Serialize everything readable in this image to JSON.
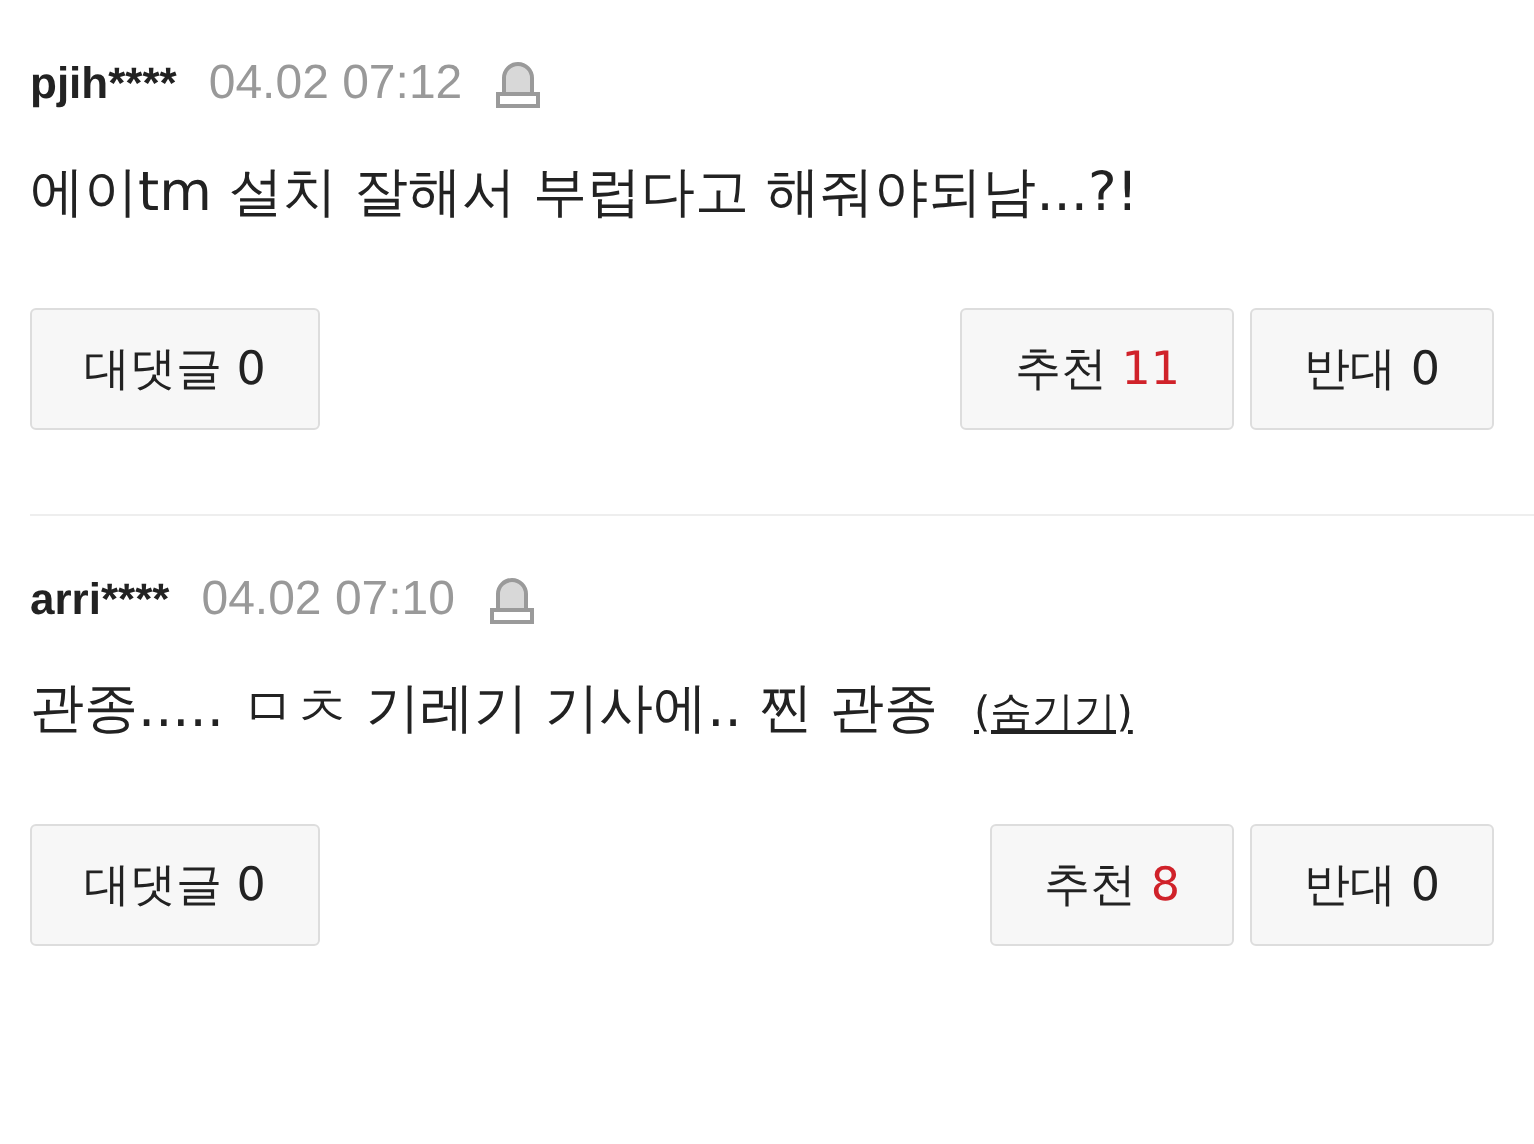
{
  "comments": [
    {
      "user": "pjih****",
      "time": "04.02 07:12",
      "text": "에이tm 설치 잘해서 부럽다고 해줘야되남...?!",
      "reply": {
        "label": "대댓글",
        "count": "0"
      },
      "like": {
        "label": "추천",
        "count": "11"
      },
      "dislike": {
        "label": "반대",
        "count": "0"
      }
    },
    {
      "user": "arri****",
      "time": "04.02 07:10",
      "text": "관종..... ㅁㅊ 기레기 기사에.. 찐 관종",
      "hide_link": "(숨기기)",
      "reply": {
        "label": "대댓글",
        "count": "0"
      },
      "like": {
        "label": "추천",
        "count": "8"
      },
      "dislike": {
        "label": "반대",
        "count": "0"
      }
    }
  ]
}
